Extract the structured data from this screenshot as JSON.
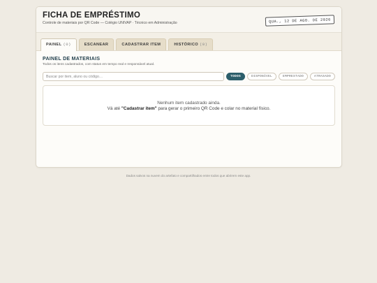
{
  "header": {
    "title": "FICHA DE EMPRÉSTIMO",
    "subtitle": "Controle de materiais por QR Code — Colégio UNIVAP · Técnico em Administração",
    "date": "QUA., 12 DE AGO. DE 2026"
  },
  "tabs": [
    {
      "label": "PAINEL",
      "count": "(0)"
    },
    {
      "label": "ESCANEAR",
      "count": ""
    },
    {
      "label": "CADASTRAR ITEM",
      "count": ""
    },
    {
      "label": "HISTÓRICO",
      "count": "(0)"
    }
  ],
  "panel": {
    "title": "PAINEL DE MATERIAIS",
    "subtitle": "Todos os itens cadastrados, com status em tempo real e responsável atual."
  },
  "search": {
    "placeholder": "Buscar por item, aluno ou código…"
  },
  "filters": [
    "TODOS",
    "DISPONÍVEL",
    "EMPRESTADO",
    "ATRASADO"
  ],
  "empty_state": {
    "line1": "Nenhum item cadastrado ainda.",
    "line2_prefix": "Vá até ",
    "line2_bold": "\"Cadastrar item\"",
    "line2_suffix": " para gerar o primeiro QR Code e colar no material físico."
  },
  "footer": "Dados salvos na nuvem do artefato e compartilhados entre todos que abrirem este app.",
  "colors": {
    "accent": "#2c5e6b",
    "title": "#1f3d4a",
    "background": "#efebe3"
  }
}
